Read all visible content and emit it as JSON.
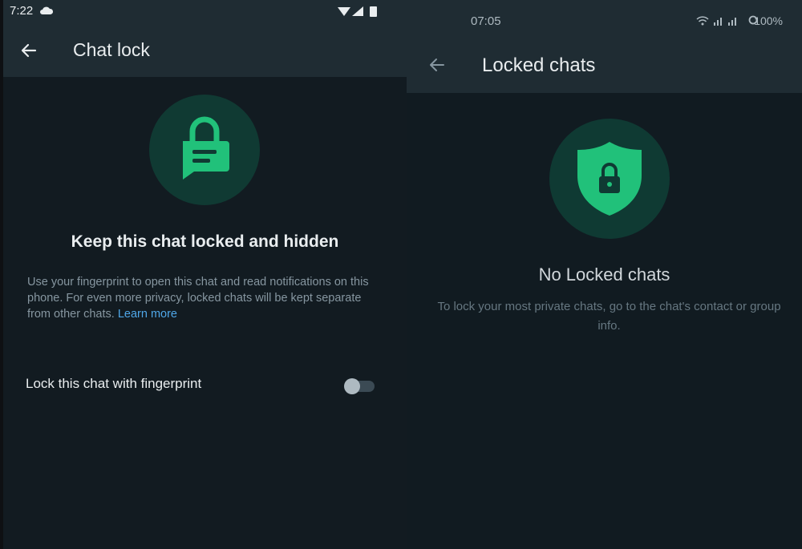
{
  "left": {
    "status": {
      "time": "7:22"
    },
    "appbar": {
      "title": "Chat lock"
    },
    "icon": "chat-lock-icon",
    "heading": "Keep this chat locked and hidden",
    "description": {
      "text": "Use your fingerprint to open this chat and read notifications on this phone. For even more privacy, locked chats will be kept separate from other chats.",
      "link": "Learn more"
    },
    "setting": {
      "label": "Lock this chat with fingerprint",
      "enabled": false
    }
  },
  "right": {
    "status": {
      "time": "07:05",
      "battery": "100%"
    },
    "appbar": {
      "title": "Locked chats"
    },
    "icon": "shield-lock-icon",
    "heading": "No Locked chats",
    "description": "To lock your most private chats, go to the chat's contact or group info."
  },
  "colors": {
    "accent": "#21c17a",
    "link": "#4fa7e8",
    "background": "#121b21",
    "appbar": "#1f2c33"
  }
}
